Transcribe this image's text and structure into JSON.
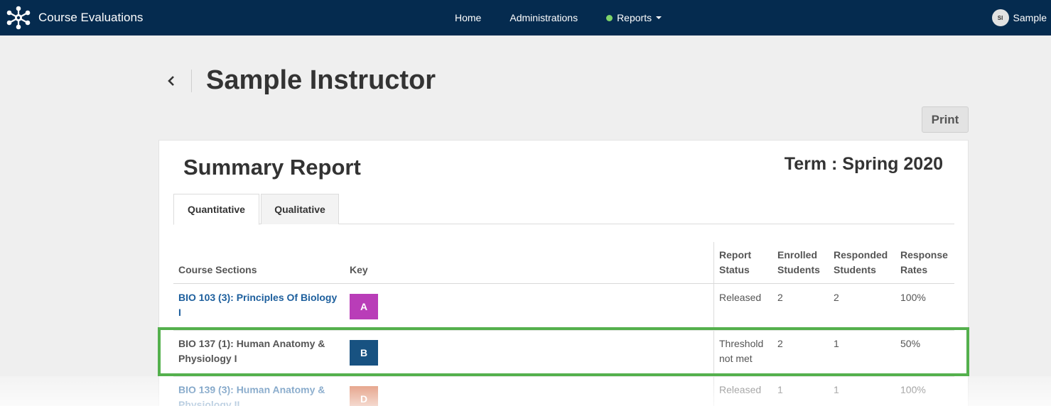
{
  "nav": {
    "app_title": "Course Evaluations",
    "home": "Home",
    "administrations": "Administrations",
    "reports": "Reports",
    "user_initials": "SI",
    "user_name": "Sample"
  },
  "page": {
    "title": "Sample Instructor",
    "print_label": "Print"
  },
  "report": {
    "title": "Summary Report",
    "term": "Term : Spring 2020",
    "tabs": [
      {
        "label": "Quantitative",
        "active": true
      },
      {
        "label": "Qualitative",
        "active": false
      }
    ],
    "columns": {
      "course_sections": "Course Sections",
      "key": "Key",
      "report_status_1": "Report",
      "report_status_2": "Status",
      "enrolled_1": "Enrolled",
      "enrolled_2": "Students",
      "responded_1": "Responded",
      "responded_2": "Students",
      "response_1": "Response",
      "response_2": "Rates"
    },
    "rows": [
      {
        "course_1": "BIO 103 (3): Principles Of Biology",
        "course_2": "I",
        "key": "A",
        "key_color": "#b93db8",
        "status_1": "Released",
        "status_2": "",
        "enrolled": "2",
        "responded": "2",
        "rate": "100%"
      },
      {
        "course_1": "BIO 137 (1): Human Anatomy &",
        "course_2": "Physiology I",
        "key": "B",
        "key_color": "#185281",
        "status_1": "Threshold",
        "status_2": "not met",
        "enrolled": "2",
        "responded": "1",
        "rate": "50%"
      },
      {
        "course_1": "BIO 139 (3): Human Anatomy &",
        "course_2": "Physiology II",
        "key": "D",
        "key_color": "#d5683f",
        "status_1": "Released",
        "status_2": "",
        "enrolled": "1",
        "responded": "1",
        "rate": "100%"
      }
    ]
  },
  "colors": {
    "navbar": "#052b4f",
    "link": "#1d5f9d",
    "highlight": "#54b04d",
    "status_dot": "#7fd46a"
  }
}
